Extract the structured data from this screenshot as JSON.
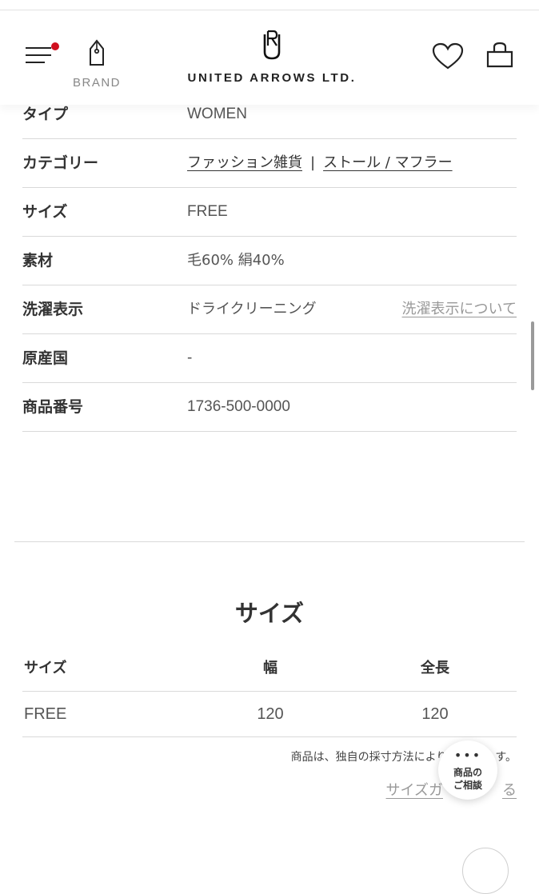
{
  "header": {
    "brand_label": "BRAND",
    "logo_text": "UNITED ARROWS LTD.",
    "icons": {
      "menu": "hamburger-menu-icon",
      "notification_color": "#d0101f",
      "brand": "tag-icon",
      "favorite": "heart-icon",
      "cart": "shopping-bag-icon"
    }
  },
  "spec": {
    "rows": [
      {
        "label": "タイプ",
        "value": "WOMEN"
      },
      {
        "label": "カテゴリー",
        "links": [
          "ファッション雑貨",
          "ストール / マフラー"
        ],
        "separator": "|"
      },
      {
        "label": "サイズ",
        "value": "FREE"
      },
      {
        "label": "素材",
        "value": "毛60% 絹40%"
      },
      {
        "label": "洗濯表示",
        "value": "ドライクリーニング",
        "link": "洗濯表示について"
      },
      {
        "label": "原産国",
        "value": "-"
      },
      {
        "label": "商品番号",
        "value": "1736-500-0000"
      }
    ]
  },
  "size_section": {
    "title": "サイズ",
    "headers": [
      "サイズ",
      "幅",
      "全長"
    ],
    "rows": [
      [
        "FREE",
        "120",
        "120"
      ]
    ],
    "note": "商品は、独自の採寸方法により採寸さ",
    "note_tail": "す。",
    "guide_link": "サイズガ",
    "guide_tail": "る"
  },
  "consult": {
    "dots": "•••",
    "line1": "商品の",
    "line2": "ご相談"
  }
}
